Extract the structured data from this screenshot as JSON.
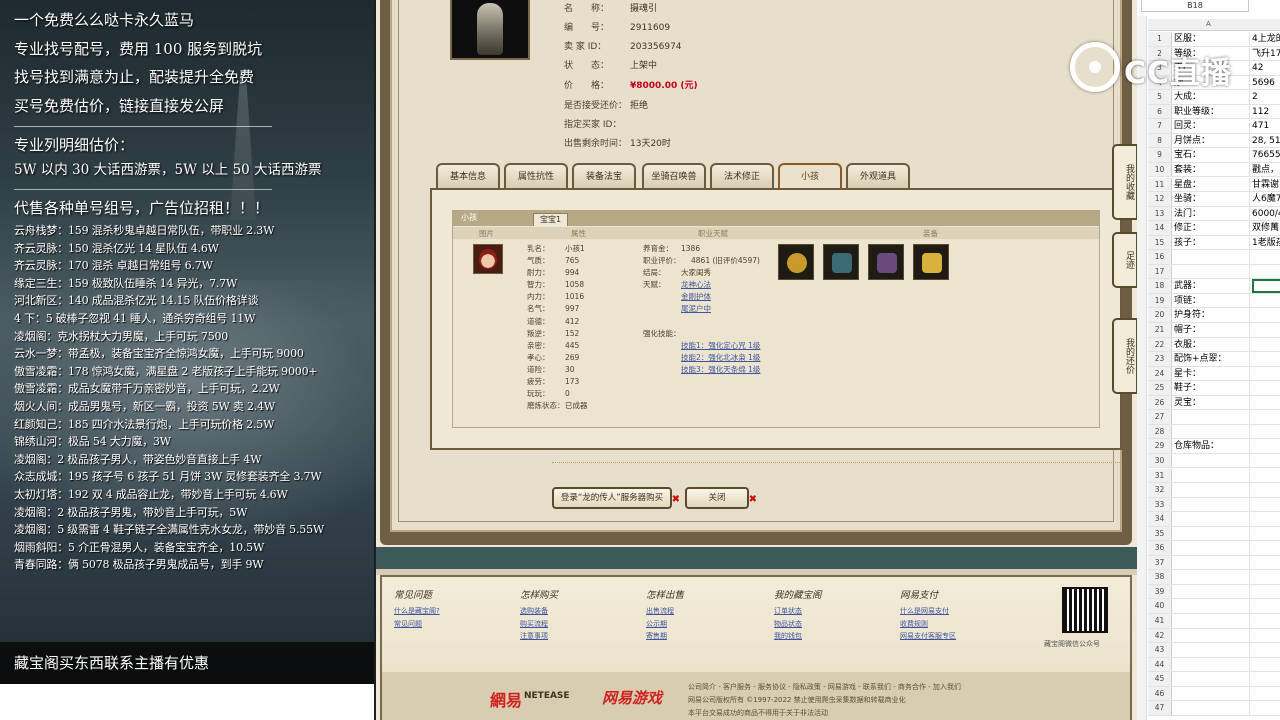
{
  "overlay": {
    "headline": [
      "一个免费么么哒卡永久蓝马",
      "专业找号配号，费用 100 服务到脱坑",
      "找号找到满意为止，配装提升全免费",
      "买号免费估价，链接直接发公屏"
    ],
    "section2": [
      "专业列明细估价：",
      "5W 以内 30 大话西游票，5W 以上 50 大话西游票"
    ],
    "section3": "代售各种单号组号，广告位招租！！！",
    "listings": [
      "云舟栈梦：159 混杀秒鬼卓越日常队伍，带职业 2.3W",
      "齐云灵脉：150 混杀亿光 14 星队伍 4.6W",
      "齐云灵脉：170 混杀 卓越日常组号 6.7W",
      "缘定三生：159 极致队伍睡杀 14 异光，7.7W",
      "河北新区：140 成品混杀亿光 14.15 队伍价格详谈",
      "4 下：5 破棒子忽视 41 睡人，通杀穷奇组号 11W",
      "凌烟阁：克水拐杖大力男魔，上手可玩 7500",
      "云水一梦：带孟极，装备宝宝齐全惊鸿女魔，上手可玩 9000",
      "傲雪凌霜：178 惊鸿女魔，满星盘 2 老版孩子上手能玩 9000+",
      "傲雪凌霜：成品女魔带千万亲密妙音，上手可玩，2.2W",
      "烟火人间：成品男鬼号，新区一霸，投资 5W 卖 2.4W",
      "红颜知己：185 四介水法景行炮，上手可玩价格 2.5W",
      "锦绣山河：极品 54 大力魔，3W",
      "凌烟阁：2 极品孩子男人，带姿色妙音直接上手 4W",
      "众志成城：195 孩子号 6 孩子 51 月饼 3W 灵修套装齐全 3.7W",
      "太初灯塔：192 双 4 成品容止龙，带妙音上手可玩 4.6W",
      "凌烟阁：2 极品孩子男鬼，带妙音上手可玩，5W",
      "凌烟阁：5 级需雷 4 鞋子链子全满属性克水女龙，带妙音 5.55W",
      "烟雨斜阳：5 介正骨混男人，装备宝宝齐全，10.5W",
      "青春同路：俩 5078 极品孩子男鬼成品号，到手 9W"
    ],
    "footer": "藏宝阁买东西联系主播有优惠"
  },
  "item": {
    "rows": [
      {
        "label": "名　　称：",
        "value": "摄魂引"
      },
      {
        "label": "编　　号：",
        "value": "2911609"
      },
      {
        "label": "卖 家  ID：",
        "value": "203356974"
      },
      {
        "label": "状　　态：",
        "value": "上架中"
      },
      {
        "label": "价　　格：",
        "value": "¥8000.00 (元)"
      },
      {
        "label": "是否接受还价：",
        "value": "拒绝"
      },
      {
        "label": "指定买家 ID：",
        "value": ""
      },
      {
        "label": "出售剩余时间：",
        "value": "13天20时"
      }
    ],
    "price_color": "#c0001a"
  },
  "tabs": [
    "基本信息",
    "属性抗性",
    "装备法宝",
    "坐骑召唤兽",
    "法术修正",
    "小孩",
    "外观道具"
  ],
  "active_tab": "小孩",
  "kid": {
    "header": "小孩",
    "sub_tab": "宝宝1",
    "columns": [
      "图片",
      "属性",
      "职业天赋",
      "装备"
    ],
    "stats": [
      {
        "k": "乳名：",
        "v": "小孩1"
      },
      {
        "k": "气质：",
        "v": "765"
      },
      {
        "k": "耐力：",
        "v": "994"
      },
      {
        "k": "智力：",
        "v": "1058"
      },
      {
        "k": "内力：",
        "v": "1016"
      },
      {
        "k": "名气：",
        "v": "997"
      },
      {
        "k": "道德：",
        "v": "412"
      },
      {
        "k": "叛逆：",
        "v": "152"
      },
      {
        "k": "亲密：",
        "v": "445"
      },
      {
        "k": "孝心：",
        "v": "269"
      },
      {
        "k": "道险：",
        "v": "30"
      },
      {
        "k": "疲劳：",
        "v": "173"
      },
      {
        "k": "玩玩：",
        "v": "0"
      },
      {
        "k": "磨炼状态：",
        "v": "已成器"
      }
    ],
    "career": [
      {
        "k": "养育金：",
        "v": "1386"
      },
      {
        "k": "职业评价：",
        "v": "4861 (旧评价4597)"
      },
      {
        "k": "结局：",
        "v": "大家闺秀"
      },
      {
        "k": "天赋：",
        "v": "龙神心法",
        "link": true
      },
      {
        "k": "",
        "v": "金刚护体",
        "link": true
      },
      {
        "k": "",
        "v": "尾泥户中",
        "link": true
      },
      {
        "k": "",
        "v": ""
      },
      {
        "k": "强化技能：",
        "v": ""
      },
      {
        "k": "",
        "v": "技能1：强化定心咒 1级",
        "link": true
      },
      {
        "k": "",
        "v": "技能2：强化北冰枭 1级",
        "link": true
      },
      {
        "k": "",
        "v": "技能3：强化天条绵 1级",
        "link": true
      }
    ]
  },
  "buttons": {
    "login": "登录“龙的传人”服务器购买",
    "close": "关闭",
    "close_mark": "✖"
  },
  "side_tabs": [
    "我的收藏",
    "足迹",
    "我的还价"
  ],
  "footer": {
    "cols": [
      {
        "h": "常见问题",
        "items": [
          "什么是藏宝阁?",
          "常见问题"
        ]
      },
      {
        "h": "怎样购买",
        "items": [
          "选购装备",
          "购买流程",
          "注意事项"
        ]
      },
      {
        "h": "怎样出售",
        "items": [
          "出售流程",
          "公示期",
          "寄售期"
        ]
      },
      {
        "h": "我的藏宝阁",
        "items": [
          "订单状态",
          "物品状态",
          "我的钱包"
        ]
      },
      {
        "h": "网易支付",
        "items": [
          "什么是网易支付",
          "收费规则",
          "网易支付客服专区"
        ]
      }
    ],
    "qr_caption": "藏宝阁微信公众号",
    "brand1": "網易",
    "brand2": "NETEASE",
    "brand3": "网易游戏",
    "copy1": "公司简介 - 客户服务 - 服务协议 - 隐私政策 - 网易游戏 - 联系我们 - 商务合作 - 加入我们",
    "copy2": "网易公司版权所有 ©1997-2022 禁止使用爬虫采集数据和转载商业化",
    "copy3": "本平台交易成功的商品不得用于关于非法活动"
  },
  "sheet": {
    "namebox": "B18",
    "col_a": "A",
    "rows": [
      {
        "n": "1",
        "a": "区服：",
        "b": "4上龙的"
      },
      {
        "n": "2",
        "a": "等级：",
        "b": "飞升17"
      },
      {
        "n": "3",
        "a": "天[",
        "b": "42"
      },
      {
        "n": "4",
        "a": "妙",
        "b": "5696"
      },
      {
        "n": "5",
        "a": "大成：",
        "b": "2"
      },
      {
        "n": "6",
        "a": "职业等级：",
        "b": "112"
      },
      {
        "n": "7",
        "a": "回灵：",
        "b": "471"
      },
      {
        "n": "8",
        "a": "月饼点：",
        "b": "28, 51"
      },
      {
        "n": "9",
        "a": "宝石：",
        "b": "766555"
      },
      {
        "n": "10",
        "a": "套装：",
        "b": "戳点，"
      },
      {
        "n": "11",
        "a": "星盘：",
        "b": "甘霖谢"
      },
      {
        "n": "12",
        "a": "坐骑：",
        "b": "人6魔7"
      },
      {
        "n": "13",
        "a": "法门：",
        "b": "6000/4"
      },
      {
        "n": "14",
        "a": "修正：",
        "b": "双修萬"
      },
      {
        "n": "15",
        "a": "孩子：",
        "b": "1老版孩"
      },
      {
        "n": "16",
        "a": "",
        "b": ""
      },
      {
        "n": "17",
        "a": "",
        "b": ""
      },
      {
        "n": "18",
        "a": "武器：",
        "b": "",
        "sel": true
      },
      {
        "n": "19",
        "a": "项链：",
        "b": ""
      },
      {
        "n": "20",
        "a": "护身符：",
        "b": ""
      },
      {
        "n": "21",
        "a": "帽子：",
        "b": ""
      },
      {
        "n": "22",
        "a": "衣服：",
        "b": ""
      },
      {
        "n": "23",
        "a": "配饰+点翠：",
        "b": ""
      },
      {
        "n": "24",
        "a": "星卡：",
        "b": ""
      },
      {
        "n": "25",
        "a": "鞋子：",
        "b": ""
      },
      {
        "n": "26",
        "a": "灵宝：",
        "b": ""
      },
      {
        "n": "27",
        "a": "",
        "b": ""
      },
      {
        "n": "28",
        "a": "",
        "b": ""
      },
      {
        "n": "29",
        "a": "仓库物品：",
        "b": ""
      },
      {
        "n": "30",
        "a": "",
        "b": ""
      },
      {
        "n": "31",
        "a": "",
        "b": ""
      },
      {
        "n": "32",
        "a": "",
        "b": ""
      },
      {
        "n": "33",
        "a": "",
        "b": ""
      },
      {
        "n": "34",
        "a": "",
        "b": ""
      },
      {
        "n": "35",
        "a": "",
        "b": ""
      },
      {
        "n": "36",
        "a": "",
        "b": ""
      },
      {
        "n": "37",
        "a": "",
        "b": ""
      },
      {
        "n": "38",
        "a": "",
        "b": ""
      },
      {
        "n": "39",
        "a": "",
        "b": ""
      },
      {
        "n": "40",
        "a": "",
        "b": ""
      },
      {
        "n": "41",
        "a": "",
        "b": ""
      },
      {
        "n": "42",
        "a": "",
        "b": ""
      },
      {
        "n": "43",
        "a": "",
        "b": ""
      },
      {
        "n": "44",
        "a": "",
        "b": ""
      },
      {
        "n": "45",
        "a": "",
        "b": ""
      },
      {
        "n": "46",
        "a": "",
        "b": ""
      },
      {
        "n": "47",
        "a": "",
        "b": ""
      }
    ]
  },
  "watermark": "CC直播",
  "icons": {
    "equip": [
      "ring-icon",
      "cloak-icon",
      "scroll-icon",
      "gold-icon"
    ],
    "equip_colors": [
      "#c79a2b",
      "#3a6a74",
      "#6a4a7a",
      "#d8b23a"
    ]
  }
}
